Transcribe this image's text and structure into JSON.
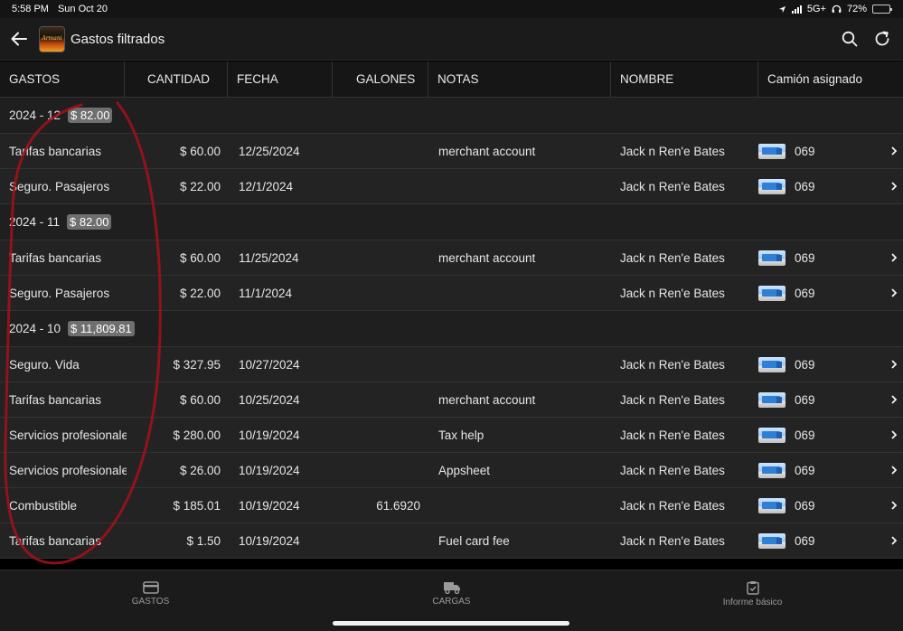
{
  "status_bar": {
    "time": "5:58 PM",
    "date": "Sun Oct 20",
    "network": "5G+",
    "battery": "72%",
    "battery_level": 0.72
  },
  "app_bar": {
    "title": "Gastos filtrados",
    "logo_text": "Armani"
  },
  "columns": [
    "GASTOS",
    "CANTIDAD",
    "FECHA",
    "GALONES",
    "NOTAS",
    "NOMBRE",
    "Camión asignado"
  ],
  "groups": [
    {
      "label": "2024 - 12",
      "total": "$ 82.00",
      "rows": [
        {
          "gasto": "Tarifas bancarias",
          "cantidad": "$ 60.00",
          "fecha": "12/25/2024",
          "galones": "",
          "notas": "merchant account",
          "nombre": "Jack n Ren'e Bates",
          "camion": "069"
        },
        {
          "gasto": "Seguro. Pasajeros",
          "cantidad": "$ 22.00",
          "fecha": "12/1/2024",
          "galones": "",
          "notas": "",
          "nombre": "Jack n Ren'e Bates",
          "camion": "069"
        }
      ]
    },
    {
      "label": "2024 - 11",
      "total": "$ 82.00",
      "rows": [
        {
          "gasto": "Tarifas bancarias",
          "cantidad": "$ 60.00",
          "fecha": "11/25/2024",
          "galones": "",
          "notas": "merchant account",
          "nombre": "Jack n Ren'e Bates",
          "camion": "069"
        },
        {
          "gasto": "Seguro. Pasajeros",
          "cantidad": "$ 22.00",
          "fecha": "11/1/2024",
          "galones": "",
          "notas": "",
          "nombre": "Jack n Ren'e Bates",
          "camion": "069"
        }
      ]
    },
    {
      "label": "2024 - 10",
      "total": "$ 11,809.81",
      "rows": [
        {
          "gasto": "Seguro. Vida",
          "cantidad": "$ 327.95",
          "fecha": "10/27/2024",
          "galones": "",
          "notas": "",
          "nombre": "Jack n Ren'e Bates",
          "camion": "069"
        },
        {
          "gasto": "Tarifas bancarias",
          "cantidad": "$ 60.00",
          "fecha": "10/25/2024",
          "galones": "",
          "notas": "merchant account",
          "nombre": "Jack n Ren'e Bates",
          "camion": "069"
        },
        {
          "gasto": "Servicios profesionales",
          "cantidad": "$ 280.00",
          "fecha": "10/19/2024",
          "galones": "",
          "notas": "Tax help",
          "nombre": "Jack n Ren'e Bates",
          "camion": "069"
        },
        {
          "gasto": "Servicios profesionales",
          "cantidad": "$ 26.00",
          "fecha": "10/19/2024",
          "galones": "",
          "notas": "Appsheet",
          "nombre": "Jack n Ren'e Bates",
          "camion": "069"
        },
        {
          "gasto": "Combustible",
          "cantidad": "$ 185.01",
          "fecha": "10/19/2024",
          "galones": "61.6920",
          "notas": "",
          "nombre": "Jack n Ren'e Bates",
          "camion": "069"
        },
        {
          "gasto": "Tarifas bancarias",
          "cantidad": "$ 1.50",
          "fecha": "10/19/2024",
          "galones": "",
          "notas": "Fuel card fee",
          "nombre": "Jack n Ren'e Bates",
          "camion": "069"
        }
      ]
    }
  ],
  "tabs": [
    {
      "label": "GASTOS",
      "icon": "credit-card-icon"
    },
    {
      "label": "CARGAS",
      "icon": "truck-icon"
    },
    {
      "label": "Informe básico",
      "icon": "clipboard-icon"
    }
  ]
}
